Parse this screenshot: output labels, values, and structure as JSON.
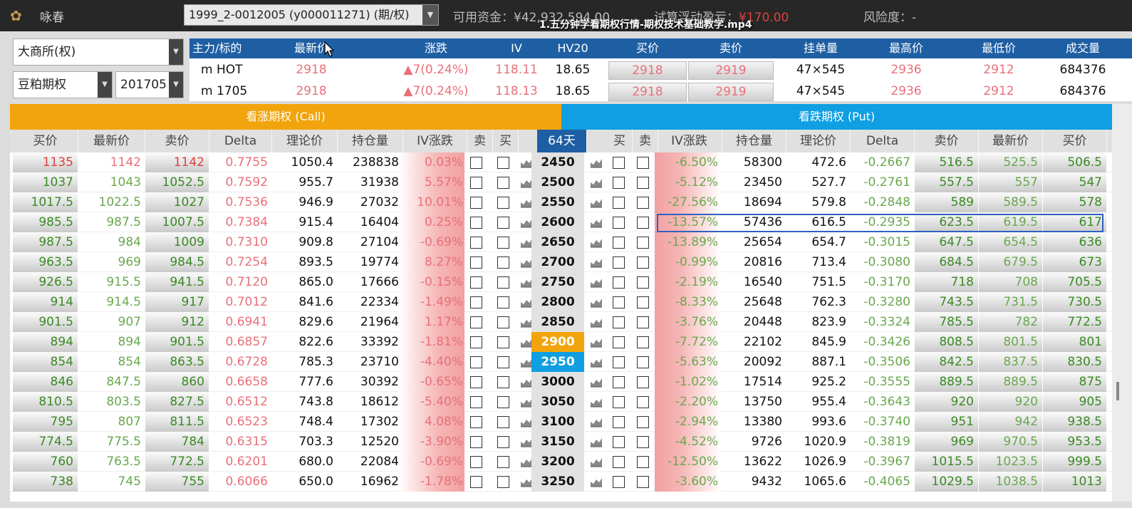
{
  "app": {
    "name": "咏春"
  },
  "account": {
    "selected": "1999_2-0012005 (y000011271) (期/权)"
  },
  "status": {
    "funds": "可用资金：¥42,932,594.00",
    "pnl_label": "试算浮动盈亏：",
    "pnl_value": "¥170.00",
    "risk": "风险度：-"
  },
  "video_title": "1.五分钟学看期权行情-期权技术基础教学.mp4",
  "selectors": {
    "exchange": "大商所(权)",
    "product": "豆粕期权",
    "month": "201705"
  },
  "quote": {
    "headers": [
      "主力/标的",
      "最新价",
      "涨跌",
      "IV",
      "HV20",
      "买价",
      "卖价",
      "挂单量",
      "最高价",
      "最低价",
      "成交量"
    ],
    "rows": [
      {
        "name": "m HOT",
        "last": "2918",
        "change": "▲7(0.24%)",
        "iv": "118.11",
        "hv20": "18.65",
        "bid": "2918",
        "ask": "2919",
        "qty": "47×545",
        "high": "2936",
        "low": "2912",
        "volume": "684376"
      },
      {
        "name": "m 1705",
        "last": "2918",
        "change": "▲7(0.24%)",
        "iv": "118.13",
        "hv20": "18.65",
        "bid": "2918",
        "ask": "2919",
        "qty": "47×545",
        "high": "2936",
        "low": "2912",
        "volume": "684376"
      }
    ]
  },
  "call_banner": "看涨期权 (Call)",
  "put_banner": "看跌期权 (Put)",
  "call_headers": [
    "买价",
    "最新价",
    "卖价",
    "Delta",
    "理论价",
    "持仓量",
    "IV涨跌",
    "卖",
    "买"
  ],
  "days": "64天",
  "put_headers": [
    "买",
    "卖",
    "IV涨跌",
    "持仓量",
    "理论价",
    "Delta",
    "卖价",
    "最新价",
    "买价"
  ],
  "rows": [
    {
      "strike": "2450",
      "c": [
        "1135",
        "1142",
        "1142",
        "0.7755",
        "1050.4",
        "238838",
        "0.03%"
      ],
      "p": [
        "-6.50%",
        "58300",
        "472.6",
        "-0.2667",
        "516.5",
        "525.5",
        "506.5"
      ]
    },
    {
      "strike": "2500",
      "c": [
        "1037",
        "1043",
        "1052.5",
        "0.7592",
        "955.7",
        "31938",
        "5.57%"
      ],
      "p": [
        "-5.12%",
        "23450",
        "527.7",
        "-0.2761",
        "557.5",
        "557",
        "547"
      ]
    },
    {
      "strike": "2550",
      "c": [
        "1017.5",
        "1022.5",
        "1027",
        "0.7536",
        "946.9",
        "27032",
        "10.01%"
      ],
      "p": [
        "-27.56%",
        "18694",
        "579.8",
        "-0.2848",
        "589",
        "589.5",
        "578"
      ]
    },
    {
      "strike": "2600",
      "c": [
        "985.5",
        "987.5",
        "1007.5",
        "0.7384",
        "915.4",
        "16404",
        "0.25%"
      ],
      "p": [
        "-13.57%",
        "57436",
        "616.5",
        "-0.2935",
        "623.5",
        "619.5",
        "617"
      ]
    },
    {
      "strike": "2650",
      "c": [
        "987.5",
        "984",
        "1009",
        "0.7310",
        "909.8",
        "27104",
        "-0.69%"
      ],
      "p": [
        "-13.89%",
        "25654",
        "654.7",
        "-0.3015",
        "647.5",
        "654.5",
        "636"
      ]
    },
    {
      "strike": "2700",
      "c": [
        "963.5",
        "969",
        "984.5",
        "0.7254",
        "893.5",
        "19774",
        "8.27%"
      ],
      "p": [
        "-0.99%",
        "20816",
        "713.4",
        "-0.3080",
        "684.5",
        "679.5",
        "673"
      ]
    },
    {
      "strike": "2750",
      "c": [
        "926.5",
        "915.5",
        "941.5",
        "0.7120",
        "865.0",
        "17666",
        "-0.15%"
      ],
      "p": [
        "-2.19%",
        "16540",
        "751.5",
        "-0.3170",
        "718",
        "708",
        "705.5"
      ]
    },
    {
      "strike": "2800",
      "c": [
        "914",
        "914.5",
        "917",
        "0.7012",
        "841.6",
        "22334",
        "-1.49%"
      ],
      "p": [
        "-8.33%",
        "25648",
        "762.3",
        "-0.3280",
        "743.5",
        "731.5",
        "730.5"
      ]
    },
    {
      "strike": "2850",
      "c": [
        "901.5",
        "907",
        "912",
        "0.6941",
        "829.6",
        "21964",
        "1.17%"
      ],
      "p": [
        "-3.76%",
        "20448",
        "823.9",
        "-0.3324",
        "785.5",
        "782",
        "772.5"
      ]
    },
    {
      "strike": "2900",
      "c": [
        "894",
        "894",
        "901.5",
        "0.6857",
        "822.6",
        "33392",
        "-1.81%"
      ],
      "p": [
        "-7.72%",
        "22102",
        "845.9",
        "-0.3426",
        "808.5",
        "801.5",
        "801"
      ]
    },
    {
      "strike": "2950",
      "c": [
        "854",
        "854",
        "863.5",
        "0.6728",
        "785.3",
        "23710",
        "-4.40%"
      ],
      "p": [
        "-5.63%",
        "20092",
        "887.1",
        "-0.3506",
        "842.5",
        "837.5",
        "830.5"
      ]
    },
    {
      "strike": "3000",
      "c": [
        "846",
        "847.5",
        "860",
        "0.6658",
        "777.6",
        "30392",
        "-0.65%"
      ],
      "p": [
        "-1.02%",
        "17514",
        "925.2",
        "-0.3555",
        "889.5",
        "889.5",
        "875"
      ]
    },
    {
      "strike": "3050",
      "c": [
        "810.5",
        "803.5",
        "827.5",
        "0.6512",
        "743.8",
        "18612",
        "-5.40%"
      ],
      "p": [
        "-2.20%",
        "13750",
        "955.4",
        "-0.3643",
        "920",
        "920",
        "905"
      ]
    },
    {
      "strike": "3100",
      "c": [
        "795",
        "807",
        "811.5",
        "0.6523",
        "748.4",
        "17302",
        "4.08%"
      ],
      "p": [
        "-2.94%",
        "13380",
        "993.6",
        "-0.3740",
        "951",
        "942",
        "938.5"
      ]
    },
    {
      "strike": "3150",
      "c": [
        "774.5",
        "775.5",
        "784",
        "0.6315",
        "703.3",
        "12520",
        "-3.90%"
      ],
      "p": [
        "-4.52%",
        "9726",
        "1020.9",
        "-0.3819",
        "969",
        "970.5",
        "953.5"
      ]
    },
    {
      "strike": "3200",
      "c": [
        "760",
        "763.5",
        "772.5",
        "0.6201",
        "680.0",
        "22084",
        "-0.69%"
      ],
      "p": [
        "-12.50%",
        "13622",
        "1026.9",
        "-0.3967",
        "1015.5",
        "1023.5",
        "999.5"
      ]
    },
    {
      "strike": "3250",
      "c": [
        "738",
        "745",
        "755",
        "0.6066",
        "650.0",
        "16962",
        "-1.78%"
      ],
      "p": [
        "-3.60%",
        "9432",
        "1065.6",
        "-0.4065",
        "1029.5",
        "1038.5",
        "1013"
      ]
    }
  ],
  "highlight_strikes": {
    "orange": "2900",
    "blue": "2950"
  },
  "colors": {
    "call": "#f2a40c",
    "put": "#0f9fe2",
    "header": "#1e5fa4",
    "up": "#e04040",
    "down": "#3a8a24"
  }
}
